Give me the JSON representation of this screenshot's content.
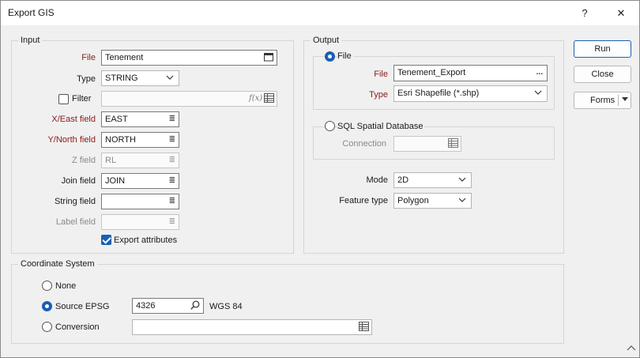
{
  "window": {
    "title": "Export GIS",
    "help": "?",
    "close": "✕"
  },
  "input": {
    "title": "Input",
    "file": {
      "label": "File",
      "value": "Tenement"
    },
    "type": {
      "label": "Type",
      "value": "STRING"
    },
    "filter": {
      "label": "Filter",
      "checked": false,
      "value": ""
    },
    "xeast": {
      "label": "X/East field",
      "value": "EAST"
    },
    "ynorth": {
      "label": "Y/North field",
      "value": "NORTH"
    },
    "z": {
      "label": "Z field",
      "value": "RL"
    },
    "join": {
      "label": "Join field",
      "value": "JOIN"
    },
    "string": {
      "label": "String field",
      "value": ""
    },
    "label": {
      "label": "Label field",
      "value": ""
    },
    "export_attributes": {
      "label": "Export attributes",
      "checked": true
    }
  },
  "output": {
    "title": "Output",
    "file_option": {
      "label": "File",
      "selected": true
    },
    "file": {
      "label": "File",
      "value": "Tenement_Export",
      "browse": "..."
    },
    "type": {
      "label": "Type",
      "value": "Esri Shapefile (*.shp)"
    },
    "sql_option": {
      "label": "SQL Spatial Database",
      "selected": false
    },
    "connection": {
      "label": "Connection",
      "value": ""
    },
    "mode": {
      "label": "Mode",
      "value": "2D"
    },
    "feature_type": {
      "label": "Feature type",
      "value": "Polygon"
    }
  },
  "buttons": {
    "run": "Run",
    "close": "Close",
    "forms": "Forms"
  },
  "coordinate_system": {
    "title": "Coordinate System",
    "none": {
      "label": "None",
      "selected": false
    },
    "source_epsg": {
      "label": "Source EPSG",
      "selected": true,
      "value": "4326",
      "name": "WGS 84"
    },
    "conversion": {
      "label": "Conversion",
      "selected": false,
      "value": ""
    }
  }
}
